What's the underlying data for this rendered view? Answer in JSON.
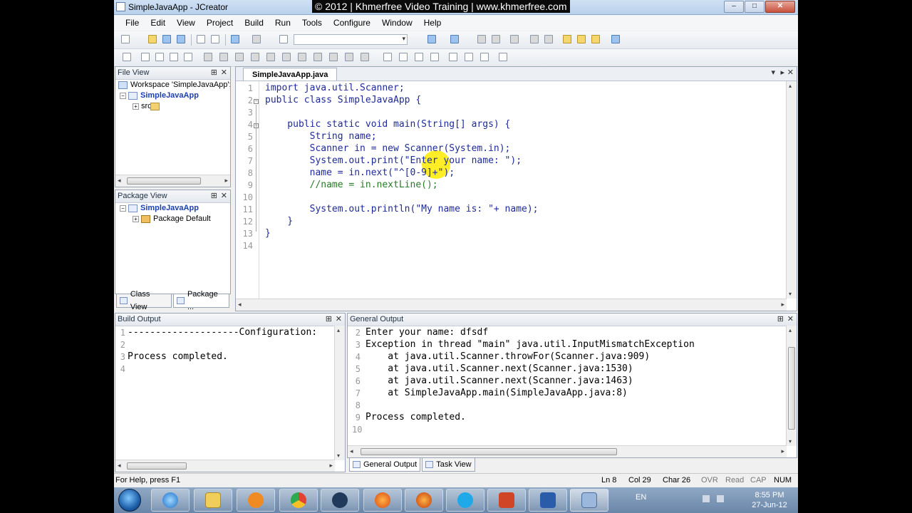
{
  "window": {
    "title": "SimpleJavaApp - JCreator",
    "banner": "© 2012 | Khmerfree Video Training | www.khmerfree.com",
    "minimize": "–",
    "maximize": "□",
    "close": "✕"
  },
  "menu": [
    "File",
    "Edit",
    "View",
    "Project",
    "Build",
    "Run",
    "Tools",
    "Configure",
    "Window",
    "Help"
  ],
  "file_view": {
    "title": "File View",
    "pin": "⊞",
    "close": "✕",
    "workspace": "Workspace 'SimpleJavaApp': 1",
    "project": "SimpleJavaApp",
    "src": "src"
  },
  "package_view": {
    "title": "Package View",
    "pin": "⊞",
    "close": "✕",
    "project": "SimpleJavaApp",
    "package": "Package Default"
  },
  "left_tabs": [
    "Class View",
    "Package ..."
  ],
  "editor": {
    "tab": "SimpleJavaApp.java",
    "lines": [
      "import java.util.Scanner;",
      "public class SimpleJavaApp {",
      "",
      "    public static void main(String[] args) {",
      "        String name;",
      "        Scanner in = new Scanner(System.in);",
      "        System.out.print(\"Enter your name: \");",
      "        name = in.next(\"^[0-9]+\");",
      "        //name = in.nextLine();",
      "",
      "        System.out.println(\"My name is: \"+ name);",
      "    }",
      "}",
      ""
    ],
    "line_numbers": [
      "1",
      "2",
      "3",
      "4",
      "5",
      "6",
      "7",
      "8",
      "9",
      "10",
      "11",
      "12",
      "13",
      "14"
    ]
  },
  "build_output": {
    "title": "Build Output",
    "lines": [
      "--------------------Configuration:",
      "",
      "Process completed.",
      ""
    ],
    "line_numbers": [
      "1",
      "2",
      "3",
      "4"
    ]
  },
  "general_output": {
    "title": "General Output",
    "lines": [
      "Enter your name: dfsdf",
      "Exception in thread \"main\" java.util.InputMismatchException",
      "    at java.util.Scanner.throwFor(Scanner.java:909)",
      "    at java.util.Scanner.next(Scanner.java:1530)",
      "    at java.util.Scanner.next(Scanner.java:1463)",
      "    at SimpleJavaApp.main(SimpleJavaApp.java:8)",
      "",
      "Process completed.",
      ""
    ],
    "line_numbers": [
      "2",
      "3",
      "4",
      "5",
      "6",
      "7",
      "8",
      "9",
      "10"
    ]
  },
  "output_tabs": [
    "General Output",
    "Task View"
  ],
  "status": {
    "help": "For Help, press F1",
    "ln": "Ln 8",
    "col": "Col 29",
    "char": "Char 26",
    "ovr": "OVR",
    "read": "Read",
    "cap": "CAP",
    "num": "NUM"
  },
  "taskbar": {
    "lang": "EN",
    "time": "8:55 PM",
    "date": "27-Jun-12"
  },
  "colors": {
    "keyword": "#1f2a9a",
    "comment": "#2a7a2a",
    "highlight": "#ffeb00"
  }
}
